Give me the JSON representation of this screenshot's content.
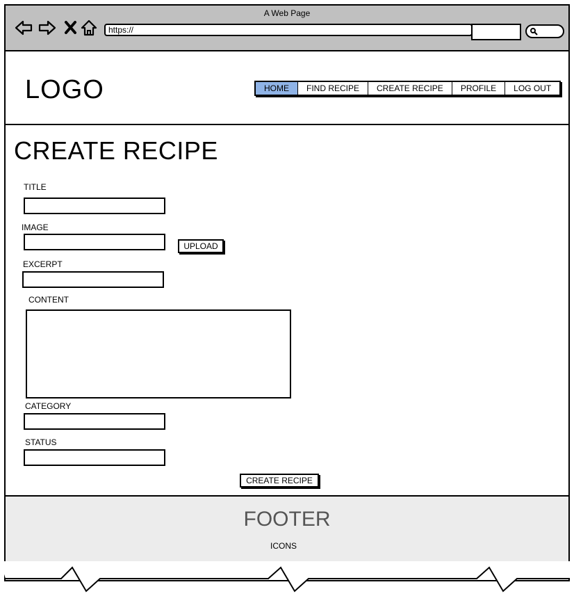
{
  "window": {
    "title": "A Web Page"
  },
  "browser": {
    "url": "https://",
    "icons": [
      "back-icon",
      "forward-icon",
      "close-icon",
      "home-icon",
      "search-icon"
    ]
  },
  "header": {
    "logo": "LOGO",
    "nav": [
      {
        "label": "HOME",
        "active": true
      },
      {
        "label": "FIND RECIPE"
      },
      {
        "label": "CREATE RECIPE"
      },
      {
        "label": "PROFILE"
      },
      {
        "label": "LOG OUT"
      }
    ]
  },
  "form": {
    "heading": "CREATE RECIPE",
    "title_label": "TITLE",
    "image_label": "IMAGE",
    "upload_label": "UPLOAD",
    "excerpt_label": "EXCERPT",
    "content_label": "CONTENT",
    "category_label": "CATEGORY",
    "status_label": "STATUS",
    "submit_label": "CREATE RECIPE"
  },
  "footer": {
    "title": "FOOTER",
    "icons_label": "ICONS"
  },
  "colors": {
    "chrome": "#c0c0c0",
    "active_nav": "#8fb3e6",
    "footer_bg": "#ececec"
  }
}
